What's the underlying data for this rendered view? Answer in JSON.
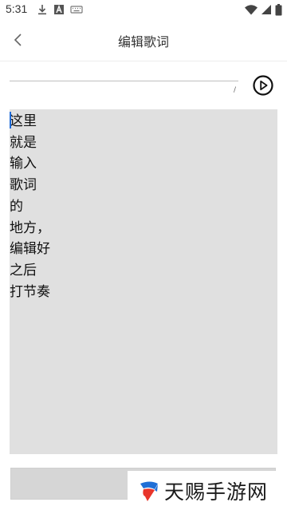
{
  "status_bar": {
    "time": "5:31",
    "icons": [
      "download-icon",
      "a-notification-icon",
      "keyboard-icon",
      "wifi-icon",
      "signal-icon",
      "battery-icon"
    ]
  },
  "header": {
    "title": "编辑歌词",
    "back_icon": "chevron-left-icon"
  },
  "title_input": {
    "value": "",
    "placeholder": "",
    "mark": "/"
  },
  "play_icon": "play-circle-icon",
  "lyrics": {
    "text": "这里\n就是\n输入\n歌词\n的\n地方，\n编辑好\n之后\n打节奏"
  },
  "bottom_button": {
    "label": ""
  },
  "watermark": {
    "text": "天赐手游网"
  },
  "colors": {
    "lyrics_background": "#e0e0e0",
    "bottom_button": "#d6d6d6",
    "caret": "#1e6bd9",
    "watermark_logo_blue": "#1f6fd6",
    "watermark_logo_red": "#e8352b"
  }
}
